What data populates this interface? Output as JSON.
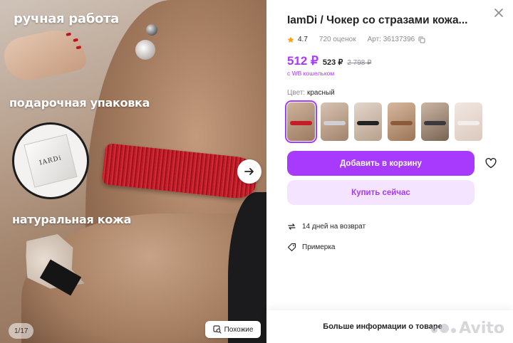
{
  "gallery": {
    "promo": {
      "line1": "ручная работа",
      "line2": "подарочная упаковка",
      "line3": "натуральная кожа"
    },
    "gift_logo": "IARDi",
    "counter": "1/17",
    "similar_label": "Похожие"
  },
  "product": {
    "title": "IamDi / Чокер со стразами кожа...",
    "rating": "4.7",
    "reviews": "720 оценок",
    "article": "Арт: 36137396"
  },
  "price": {
    "main": "512 ₽",
    "without_wallet": "523 ₽",
    "old": "2 798 ₽",
    "wallet_note": "с WB кошельком"
  },
  "color": {
    "label": "Цвет:",
    "value": "красный",
    "variants": [
      "red",
      "silver",
      "black",
      "bronze",
      "black-crystal",
      "light"
    ]
  },
  "actions": {
    "add_to_cart": "Добавить в корзину",
    "buy_now": "Купить сейчас"
  },
  "features": {
    "returns": "14 дней на возврат",
    "fitting": "Примерка"
  },
  "footer": {
    "more_info": "Больше информации о товаре",
    "watermark": "Avito"
  },
  "colors": {
    "accent": "#a73afd",
    "accent_light": "#f4e4ff",
    "text": "#242424",
    "muted": "#8b8b95"
  }
}
